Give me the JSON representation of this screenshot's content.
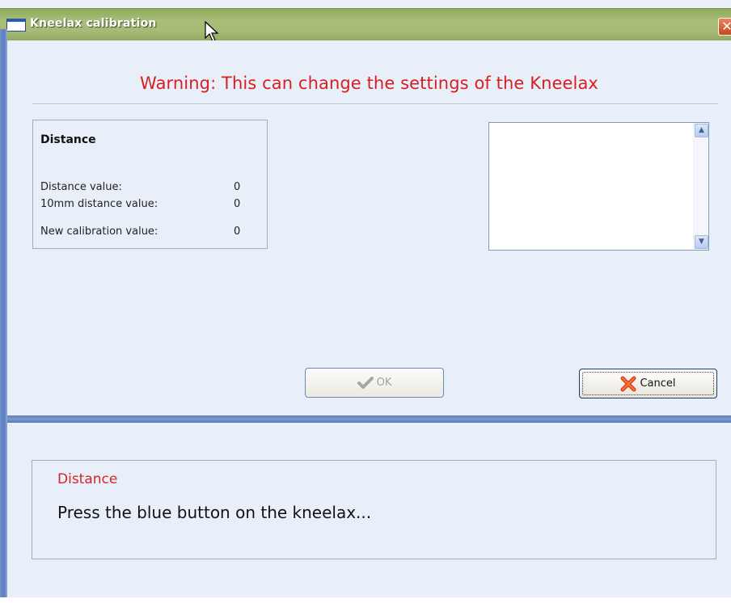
{
  "window": {
    "title": "Kneelax calibration",
    "close_glyph": "✕"
  },
  "warning": {
    "text": "Warning: This can change the settings of the Kneelax",
    "color": "#d81f1f"
  },
  "distance_panel": {
    "title": "Distance",
    "rows": [
      {
        "label": "Distance value:",
        "value": "0"
      },
      {
        "label": "10mm distance value:",
        "value": "0"
      },
      {
        "label": "New calibration value:",
        "value": "0"
      }
    ]
  },
  "listbox": {
    "items": [],
    "scroll_up_icon": "scroll-up-arrow",
    "scroll_down_icon": "scroll-down-arrow"
  },
  "buttons": {
    "ok_label": "OK",
    "ok_icon": "checkmark-icon",
    "ok_enabled": false,
    "cancel_label": "Cancel",
    "cancel_icon": "red-x-icon"
  },
  "status": {
    "title": "Distance",
    "message": "Press the blue button on the kneelax...",
    "title_color": "#d02727"
  }
}
